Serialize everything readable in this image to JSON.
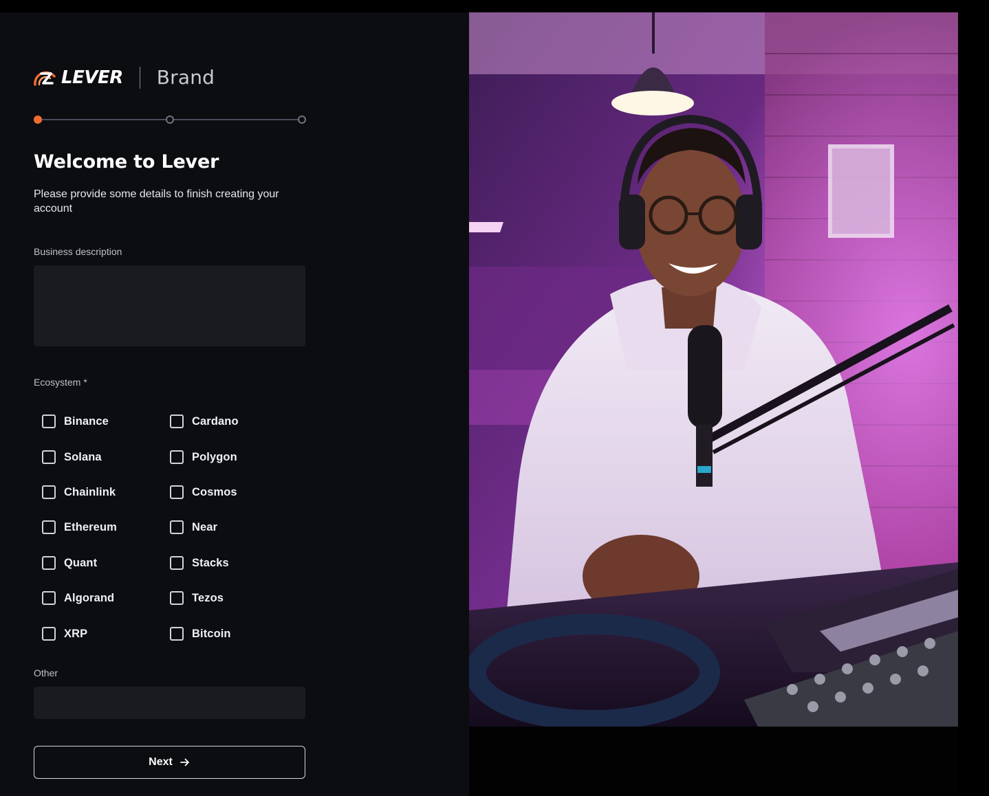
{
  "brand": {
    "logo_text": "LEVER",
    "suffix": "Brand",
    "accent_color": "#f26b30"
  },
  "stepper": {
    "steps": 3,
    "current_step": 1
  },
  "form": {
    "title": "Welcome to Lever",
    "subtitle": "Please provide some details to finish creating your account",
    "business_description": {
      "label": "Business description",
      "value": "",
      "placeholder": ""
    },
    "ecosystem": {
      "label": "Ecosystem *",
      "options": [
        {
          "label": "Binance",
          "checked": false
        },
        {
          "label": "Cardano",
          "checked": false
        },
        {
          "label": "Solana",
          "checked": false
        },
        {
          "label": "Polygon",
          "checked": false
        },
        {
          "label": "Chainlink",
          "checked": false
        },
        {
          "label": "Cosmos",
          "checked": false
        },
        {
          "label": "Ethereum",
          "checked": false
        },
        {
          "label": "Near",
          "checked": false
        },
        {
          "label": "Quant",
          "checked": false
        },
        {
          "label": "Stacks",
          "checked": false
        },
        {
          "label": "Algorand",
          "checked": false
        },
        {
          "label": "Tezos",
          "checked": false
        },
        {
          "label": "XRP",
          "checked": false
        },
        {
          "label": "Bitcoin",
          "checked": false
        }
      ]
    },
    "other": {
      "label": "Other",
      "value": "",
      "placeholder": ""
    },
    "next_button": {
      "label": "Next",
      "icon": "arrow-right-icon"
    }
  },
  "hero_image": {
    "icon": "podcaster-photo"
  }
}
